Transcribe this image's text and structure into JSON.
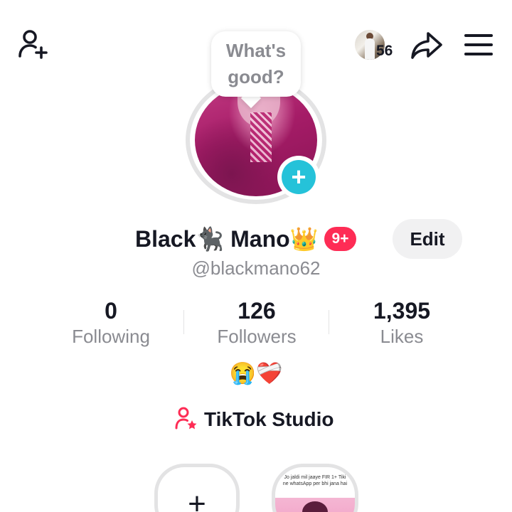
{
  "top_bar": {
    "add_user_icon": "add-user-icon",
    "viewers_count": "56",
    "share_icon": "share-icon",
    "menu_icon": "hamburger-menu-icon"
  },
  "note": {
    "text": "What's good?"
  },
  "profile": {
    "display_name": "Black🐈‍⬛ Mano👑",
    "notification_badge": "9+",
    "edit_label": "Edit",
    "username": "@blackmano62",
    "bio": "😭❤️‍🩹"
  },
  "stats": [
    {
      "value": "0",
      "label": "Following"
    },
    {
      "value": "126",
      "label": "Followers"
    },
    {
      "value": "1,395",
      "label": "Likes"
    }
  ],
  "studio": {
    "label": "TikTok Studio",
    "icon": "user-star-icon",
    "icon_color": "#fe2c55"
  },
  "stories": {
    "new_label": "+",
    "thumb_text": "Jo jaldi mil jaaye FIR 1+ Tiki ne whatsApp per bhi jana hai"
  },
  "colors": {
    "accent_pink": "#fe2c55",
    "story_plus": "#25c2d9",
    "muted_text": "#8a8b91"
  }
}
